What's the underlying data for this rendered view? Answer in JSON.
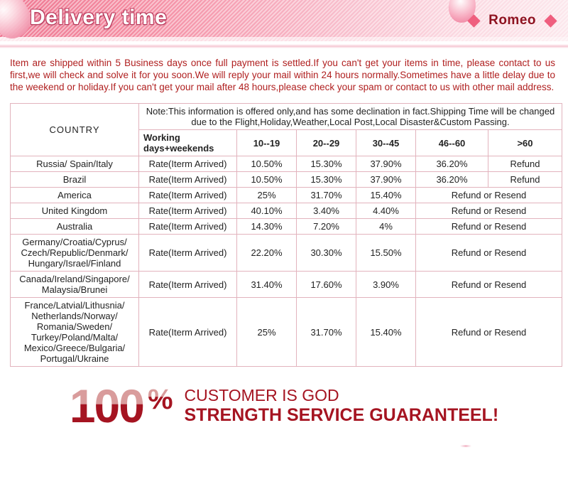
{
  "header": {
    "title": "Delivery time",
    "brand": "Romeo",
    "diamond_color": "#ef5e7e",
    "title_color": "#ffffff",
    "brand_color": "#8e1220"
  },
  "intro": {
    "text": "Item are shipped within 5 Business days once full payment is settled.If you can't get your items in time, please contact to us first,we will check and solve it for you soon.We will reply your mail within 24 hours normally.Sometimes have a little delay due to the weekend or holiday.If you can't get your mail after 48 hours,please check your spam or contact to us with other mail address.",
    "color": "#b02020"
  },
  "table": {
    "country_header": "COUNTRY",
    "note": "Note:This information is offered only,and has some declination in fact.Shipping Time will be changed due to the Flight,Holiday,Weather,Local Post,Local Disaster&Custom Passing.",
    "columns": {
      "working": "Working days+weekends",
      "r1": "10--19",
      "r2": "20--29",
      "r3": "30--45",
      "r4": "46--60",
      "r5": ">60"
    },
    "rate_label": "Rate(Iterm Arrived)",
    "rows": [
      {
        "country": "Russia/ Spain/Italy",
        "country_style": "red",
        "rate": "Rate(Iterm Arrived)",
        "v1": "10.50%",
        "v2": "15.30%",
        "v3": "37.90%",
        "v4": "36.20%",
        "v5": "Refund",
        "merged": false
      },
      {
        "country": "Brazil",
        "country_style": "red",
        "rate": "Rate(Iterm Arrived)",
        "v1": "10.50%",
        "v2": "15.30%",
        "v3": "37.90%",
        "v4": "36.20%",
        "v5": "Refund",
        "merged": false
      },
      {
        "country": "America",
        "country_style": "red",
        "rate": "Rate(Iterm Arrived)",
        "v1": "25%",
        "v2": "31.70%",
        "v3": "15.40%",
        "v4": "Refund or Resend",
        "merged": true
      },
      {
        "country": "United Kingdom",
        "country_style": "black",
        "rate": "Rate(Iterm Arrived)",
        "v1": "40.10%",
        "v2": "3.40%",
        "v3": "4.40%",
        "v4": "Refund or Resend",
        "merged": true
      },
      {
        "country": "Australia",
        "country_style": "black",
        "rate": "Rate(Iterm Arrived)",
        "v1": "14.30%",
        "v2": "7.20%",
        "v3": "4%",
        "v4": "Refund or Resend",
        "merged": true
      },
      {
        "country": "Germany/Croatia/Cyprus/\nCzech/Republic/Denmark/\nHungary/Israel/Finland",
        "country_style": "multi",
        "rate": "Rate(Iterm Arrived)",
        "v1": "22.20%",
        "v2": "30.30%",
        "v3": "15.50%",
        "v4": "Refund or Resend",
        "merged": true
      },
      {
        "country": "Canada/Ireland/Singapore/\nMalaysia/Brunei",
        "country_style": "multi",
        "rate": "Rate(Iterm Arrived)",
        "v1": "31.40%",
        "v2": "17.60%",
        "v3": "3.90%",
        "v4": "Refund or Resend",
        "merged": true
      },
      {
        "country": "France/Latvial/Lithusnia/\nNetherlands/Norway/\nRomania/Sweden/\nTurkey/Poland/Malta/\nMexico/Greece/Bulgaria/\nPortugal/Ukraine",
        "country_style": "multi",
        "rate": "Rate(Iterm Arrived)",
        "v1": "25%",
        "v2": "31.70%",
        "v3": "15.40%",
        "v4": "Refund or Resend",
        "merged": true
      }
    ]
  },
  "footer": {
    "number": "100",
    "percent": "%",
    "line1": "CUSTOMER IS GOD",
    "line2": "STRENGTH SERVICE GUARANTEEL!",
    "color": "#a51421"
  }
}
